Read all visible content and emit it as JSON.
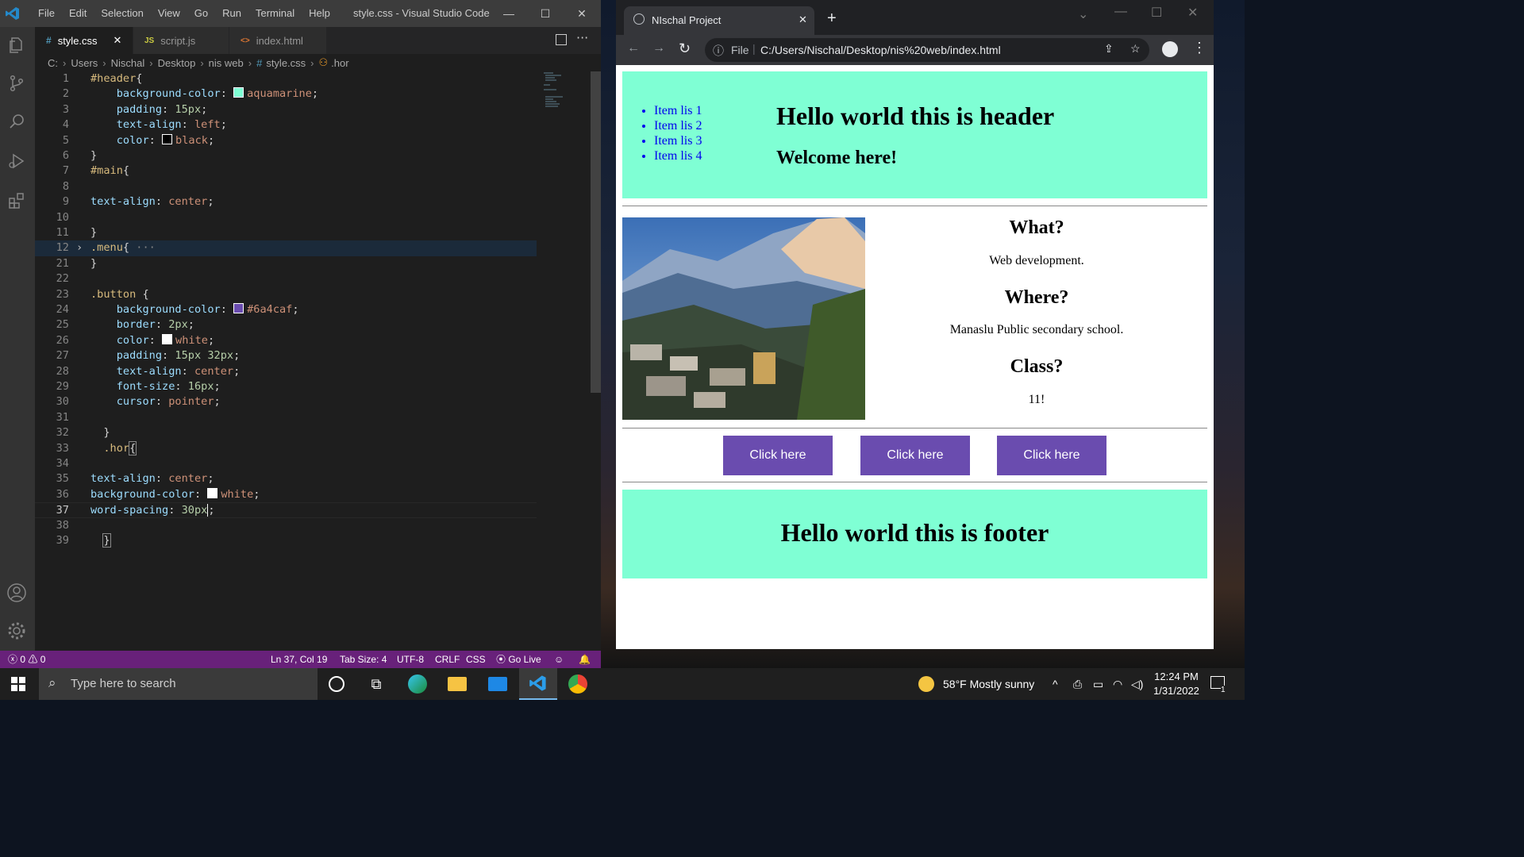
{
  "vscode": {
    "window_title": "style.css - Visual Studio Code",
    "menu": [
      "File",
      "Edit",
      "Selection",
      "View",
      "Go",
      "Run",
      "Terminal",
      "Help"
    ],
    "tabs": [
      {
        "icon": "#",
        "label": "style.css",
        "close": "✕"
      },
      {
        "icon": "JS",
        "label": "script.js"
      },
      {
        "icon": "<>",
        "label": "index.html"
      }
    ],
    "breadcrumb": [
      "C:",
      "Users",
      "Nischal",
      "Desktop",
      "nis web",
      "style.css",
      ".hor"
    ],
    "code_lines": [
      {
        "n": "1",
        "code": "#header{"
      },
      {
        "n": "2",
        "code": "    background-color: aquamarine;"
      },
      {
        "n": "3",
        "code": "    padding: 15px;"
      },
      {
        "n": "4",
        "code": "    text-align: left;"
      },
      {
        "n": "5",
        "code": "    color: black;"
      },
      {
        "n": "6",
        "code": "}"
      },
      {
        "n": "7",
        "code": "#main{"
      },
      {
        "n": "8",
        "code": ""
      },
      {
        "n": "9",
        "code": "text-align: center;"
      },
      {
        "n": "10",
        "code": ""
      },
      {
        "n": "11",
        "code": "}"
      },
      {
        "n": "12",
        "code": ".menu{ ···"
      },
      {
        "n": "21",
        "code": "}"
      },
      {
        "n": "22",
        "code": ""
      },
      {
        "n": "23",
        "code": ".button {"
      },
      {
        "n": "24",
        "code": "    background-color: #6a4caf;"
      },
      {
        "n": "25",
        "code": "    border: 2px;"
      },
      {
        "n": "26",
        "code": "    color: white;"
      },
      {
        "n": "27",
        "code": "    padding: 15px 32px;"
      },
      {
        "n": "28",
        "code": "    text-align: center;"
      },
      {
        "n": "29",
        "code": "    font-size: 16px;"
      },
      {
        "n": "30",
        "code": "    cursor: pointer;"
      },
      {
        "n": "31",
        "code": ""
      },
      {
        "n": "32",
        "code": "  }"
      },
      {
        "n": "33",
        "code": "  .hor{"
      },
      {
        "n": "34",
        "code": ""
      },
      {
        "n": "35",
        "code": "text-align: center;"
      },
      {
        "n": "36",
        "code": "background-color: white;"
      },
      {
        "n": "37",
        "code": "word-spacing: 30px;"
      },
      {
        "n": "38",
        "code": ""
      },
      {
        "n": "39",
        "code": "  }"
      }
    ],
    "status": {
      "errors": "0",
      "warnings": "0",
      "position": "Ln 37, Col 19",
      "tab_size": "Tab Size: 4",
      "encoding": "UTF-8",
      "eol": "CRLF",
      "language": "CSS",
      "go_live": "Go Live"
    },
    "colors": {
      "accent": "#68217a",
      "swatch_aquamarine": "#7fffd4",
      "swatch_black": "#000000",
      "swatch_purple": "#6a4caf",
      "swatch_white": "#ffffff"
    }
  },
  "chrome": {
    "tab_title": "NIschal Project",
    "url_prefix": "File",
    "url": "C:/Users/Nischal/Desktop/nis%20web/index.html",
    "page": {
      "menu_items": [
        "Item lis 1",
        "Item lis 2",
        "Item lis 3",
        "Item lis 4"
      ],
      "header_title": "Hello world this is header",
      "header_subtitle": "Welcome here!",
      "sections": [
        {
          "heading": "What?",
          "text": "Web development."
        },
        {
          "heading": "Where?",
          "text": "Manaslu Public secondary school."
        },
        {
          "heading": "Class?",
          "text": "11!"
        }
      ],
      "buttons": [
        "Click here",
        "Click here",
        "Click here"
      ],
      "footer_title": "Hello world this is footer"
    }
  },
  "taskbar": {
    "search_placeholder": "Type here to search",
    "weather": "58°F  Mostly sunny",
    "time": "12:24 PM",
    "date": "1/31/2022",
    "notification_count": "1"
  }
}
